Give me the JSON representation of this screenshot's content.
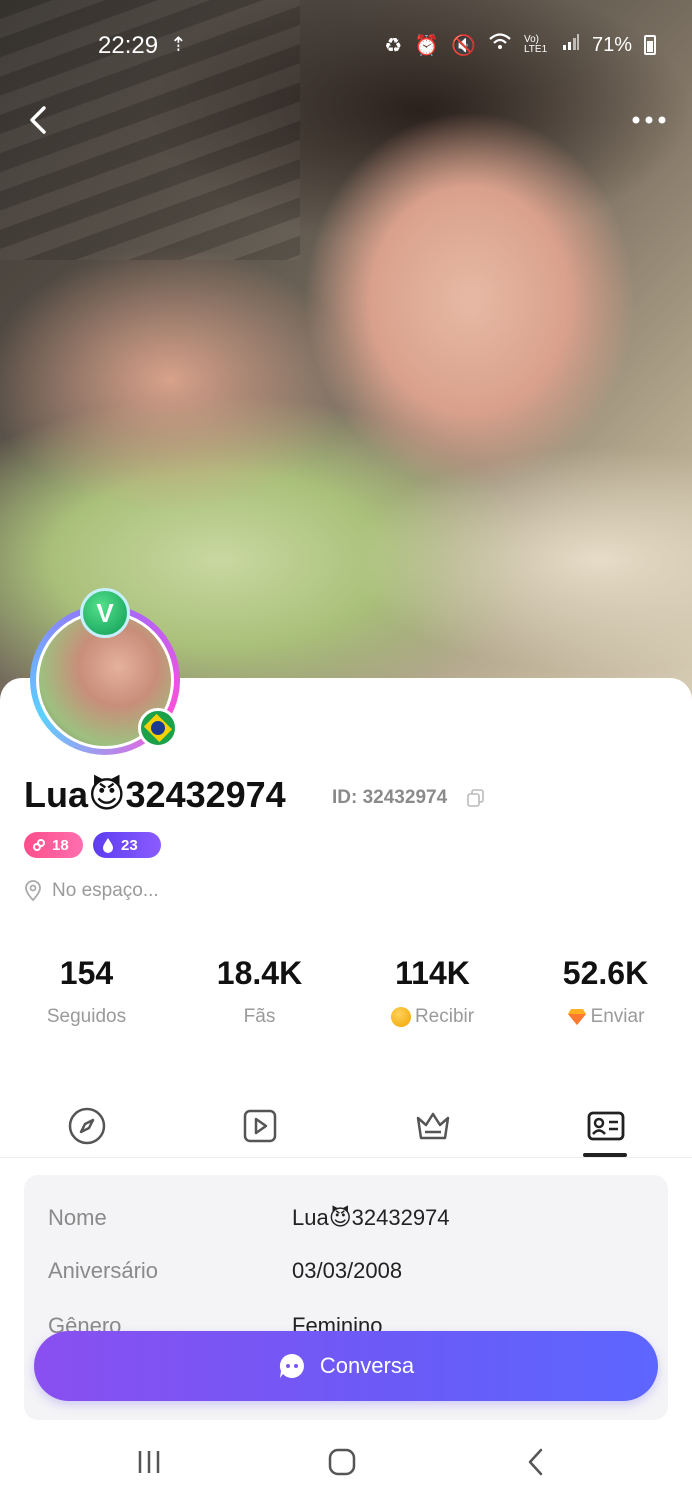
{
  "status_bar": {
    "time": "22:29",
    "battery": "71%",
    "icons": [
      "upload-icon",
      "battery-saver-icon",
      "alarm-icon",
      "mute-icon",
      "wifi-icon",
      "lte-icon",
      "signal-icon",
      "battery-icon"
    ],
    "network": "Vo) LTE1"
  },
  "profile": {
    "username": "Lua😈32432974",
    "id_label": "ID: 32432974",
    "avatar_badge": "V",
    "level_badge": "18",
    "fans_badge": "23",
    "location": "No espaço..."
  },
  "stats": [
    {
      "value": "154",
      "label": "Seguidos"
    },
    {
      "value": "18.4K",
      "label": "Fãs"
    },
    {
      "value": "114K",
      "label": "Recibir"
    },
    {
      "value": "52.6K",
      "label": "Enviar"
    }
  ],
  "tabs": [
    {
      "icon": "compass-icon"
    },
    {
      "icon": "video-icon"
    },
    {
      "icon": "crown-icon"
    },
    {
      "icon": "profile-card-icon",
      "active": true
    }
  ],
  "info": {
    "rows": [
      {
        "label": "Nome",
        "value": "Lua😈32432974"
      },
      {
        "label": "Aniversário",
        "value": "03/03/2008"
      },
      {
        "label": "Gênero",
        "value": "Feminino"
      }
    ]
  },
  "chat_button": {
    "label": "Conversa"
  },
  "colors": {
    "accent": "#7a57f5",
    "badge_pink": "#ff4e8b",
    "badge_purple": "#6a44f3"
  }
}
